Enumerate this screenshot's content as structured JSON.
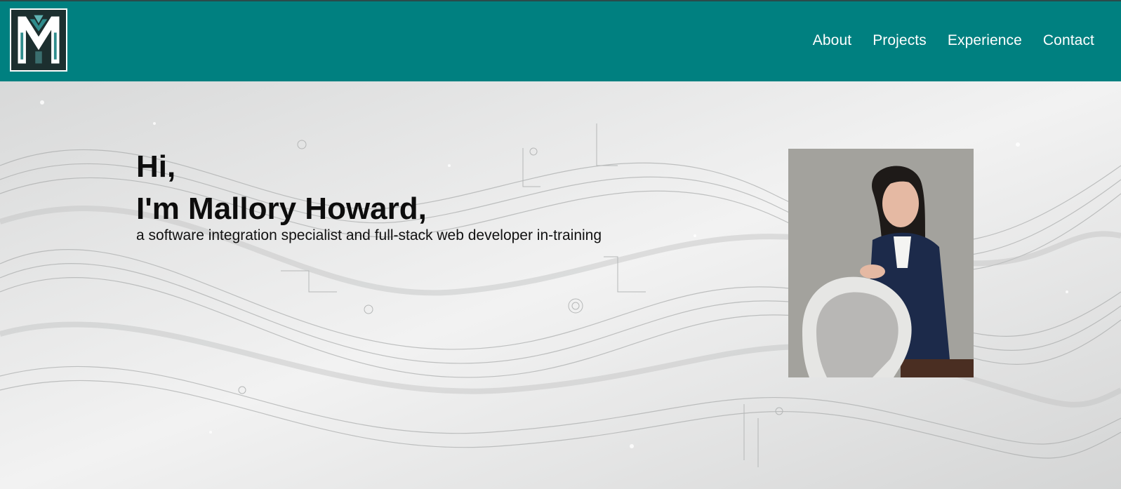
{
  "nav": {
    "logo_icon": "monogram-logo-icon",
    "links": [
      "About",
      "Projects",
      "Experience",
      "Contact"
    ]
  },
  "hero": {
    "greeting_line1": "Hi,",
    "greeting_line2": "I'm Mallory Howard,",
    "tagline": "a software integration specialist and full-stack web developer in-training",
    "background_icon": "abstract-waves-circuit-background",
    "portrait_icon": "profile-photo"
  },
  "colors": {
    "navbar": "#008080",
    "nav_text": "#ffffff",
    "hero_text": "#0d0d0d"
  }
}
